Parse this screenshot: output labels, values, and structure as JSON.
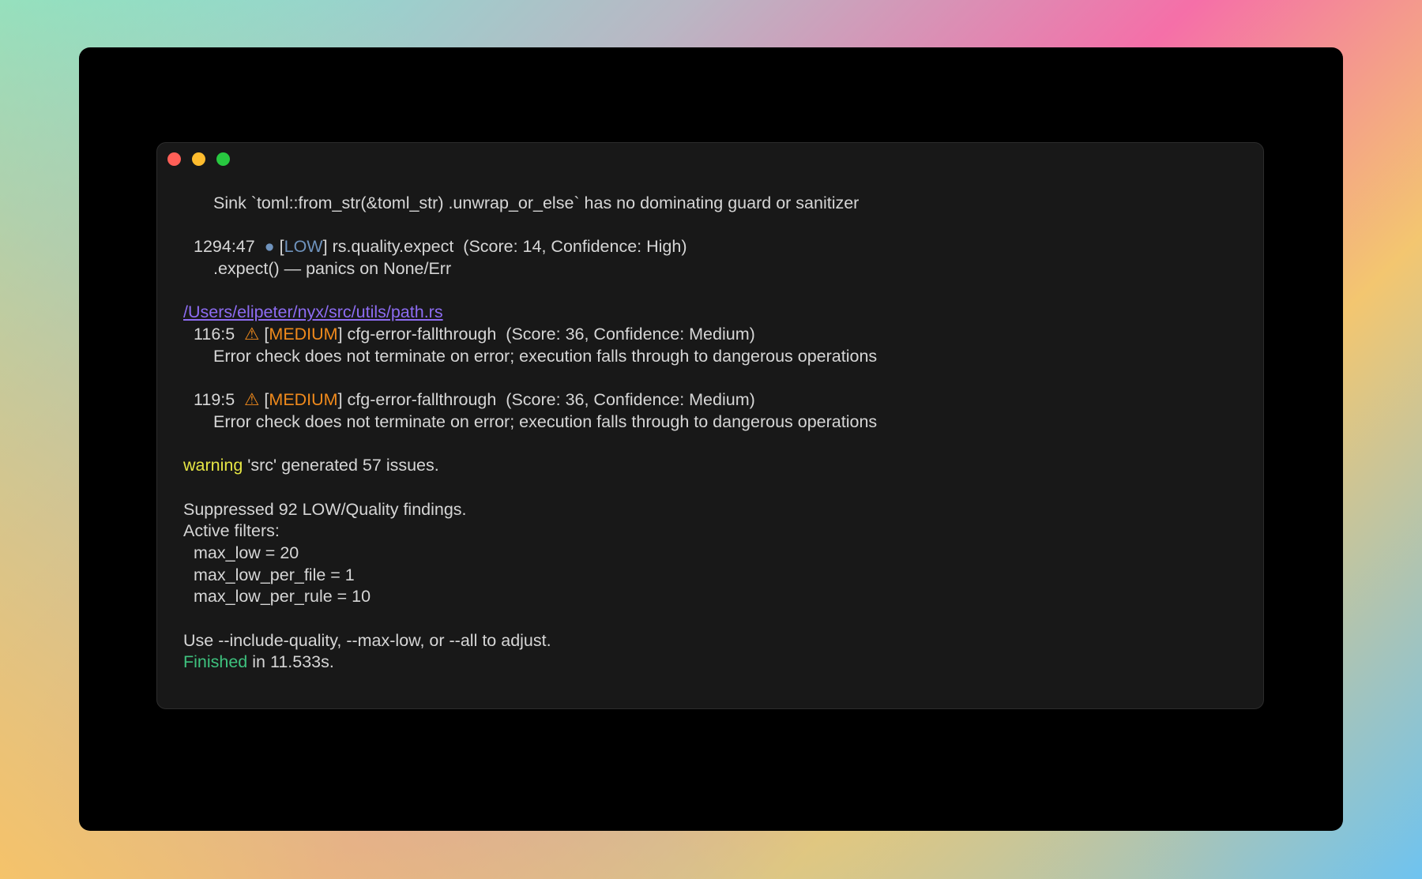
{
  "colors": {
    "terminal_bg": "#181818",
    "text": "#d6d6d6",
    "low": "#6f93bd",
    "medium": "#f08a1c",
    "link": "#8d6cf2",
    "warning": "#e6e645",
    "finished": "#3ec27e",
    "close_button": "#ff5f57",
    "minimize_button": "#febc2e",
    "maximize_button": "#28c840"
  },
  "finding_0": {
    "message": "Sink `toml::from_str(&toml_str) .unwrap_or_else` has no dominating guard or sanitizer"
  },
  "finding_1": {
    "location": "1294:47",
    "icon": "●",
    "severity": "LOW",
    "rule": "rs.quality.expect",
    "meta": "(Score: 14, Confidence: High)",
    "message": ".expect() — panics on None/Err"
  },
  "file_path": "/Users/elipeter/nyx/src/utils/path.rs",
  "finding_2": {
    "location": "116:5",
    "icon": "⚠",
    "severity": "MEDIUM",
    "rule": "cfg-error-fallthrough",
    "meta": "(Score: 36, Confidence: Medium)",
    "message": "Error check does not terminate on error; execution falls through to dangerous operations"
  },
  "finding_3": {
    "location": "119:5",
    "icon": "⚠",
    "severity": "MEDIUM",
    "rule": "cfg-error-fallthrough",
    "meta": "(Score: 36, Confidence: Medium)",
    "message": "Error check does not terminate on error; execution falls through to dangerous operations"
  },
  "summary": {
    "warning_label": "warning",
    "warning_text": "'src' generated 57 issues.",
    "suppressed": "Suppressed 92 LOW/Quality findings.",
    "filters_header": "Active filters:",
    "filters": [
      "max_low = 20",
      "max_low_per_file = 1",
      "max_low_per_rule = 10"
    ],
    "hint": "Use --include-quality, --max-low, or --all to adjust.",
    "finished_label": "Finished",
    "finished_text": "in 11.533s."
  }
}
